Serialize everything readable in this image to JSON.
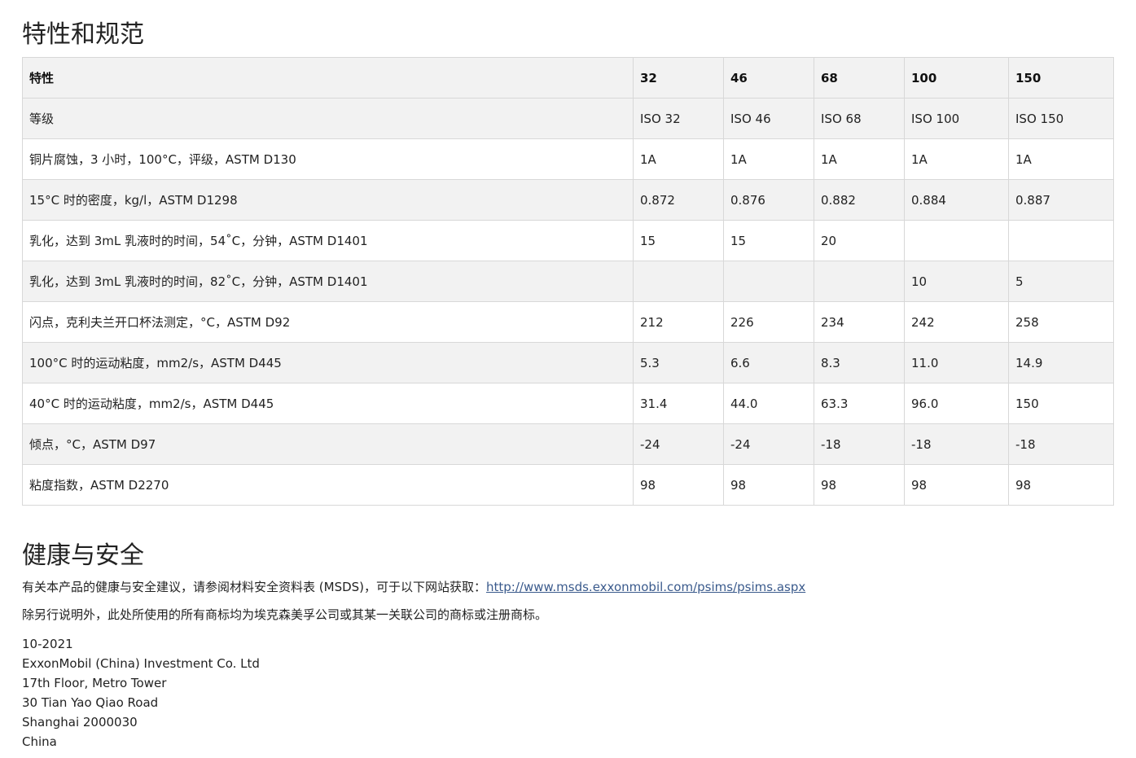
{
  "specs_section": {
    "title": "特性和规范",
    "headers": [
      "特性",
      "32",
      "46",
      "68",
      "100",
      "150"
    ],
    "rows": [
      [
        "等级",
        "ISO 32",
        "ISO 46",
        "ISO 68",
        "ISO 100",
        "ISO 150"
      ],
      [
        "铜片腐蚀，3 小时，100°C，评级，ASTM D130",
        "1A",
        "1A",
        "1A",
        "1A",
        "1A"
      ],
      [
        "15°C 时的密度，kg/l，ASTM D1298",
        "0.872",
        "0.876",
        "0.882",
        "0.884",
        "0.887"
      ],
      [
        "乳化，达到 3mL 乳液时的时间，54˚C，分钟，ASTM D1401",
        "15",
        "15",
        "20",
        "",
        ""
      ],
      [
        "乳化，达到 3mL 乳液时的时间，82˚C，分钟，ASTM D1401",
        "",
        "",
        "",
        "10",
        "5"
      ],
      [
        "闪点，克利夫兰开口杯法测定，°C，ASTM D92",
        "212",
        "226",
        "234",
        "242",
        "258"
      ],
      [
        "100°C 时的运动粘度，mm2/s，ASTM D445",
        "5.3",
        "6.6",
        "8.3",
        "11.0",
        "14.9"
      ],
      [
        "40°C 时的运动粘度，mm2/s，ASTM D445",
        "31.4",
        "44.0",
        "63.3",
        "96.0",
        "150"
      ],
      [
        "倾点，°C，ASTM D97",
        "-24",
        "-24",
        "-18",
        "-18",
        "-18"
      ],
      [
        "粘度指数，ASTM D2270",
        "98",
        "98",
        "98",
        "98",
        "98"
      ]
    ]
  },
  "health_section": {
    "title": "健康与安全",
    "msds_text": "有关本产品的健康与安全建议，请参阅材料安全资料表 (MSDS)，可于以下网站获取：",
    "msds_link": "http://www.msds.exxonmobil.com/psims/psims.aspx",
    "trademark_text": "除另行说明外，此处所使用的所有商标均为埃克森美孚公司或其某一关联公司的商标或注册商标。"
  },
  "footer": {
    "date": "10-2021",
    "address_lines": [
      "ExxonMobil (China) Investment Co. Ltd",
      "17th Floor, Metro Tower",
      "30 Tian Yao Qiao Road",
      "Shanghai 2000030",
      "China"
    ]
  },
  "colors": {
    "row_odd": "#f2f2f2",
    "row_even": "#ffffff",
    "border": "#d8d8d8",
    "link": "#3a5a8c"
  }
}
